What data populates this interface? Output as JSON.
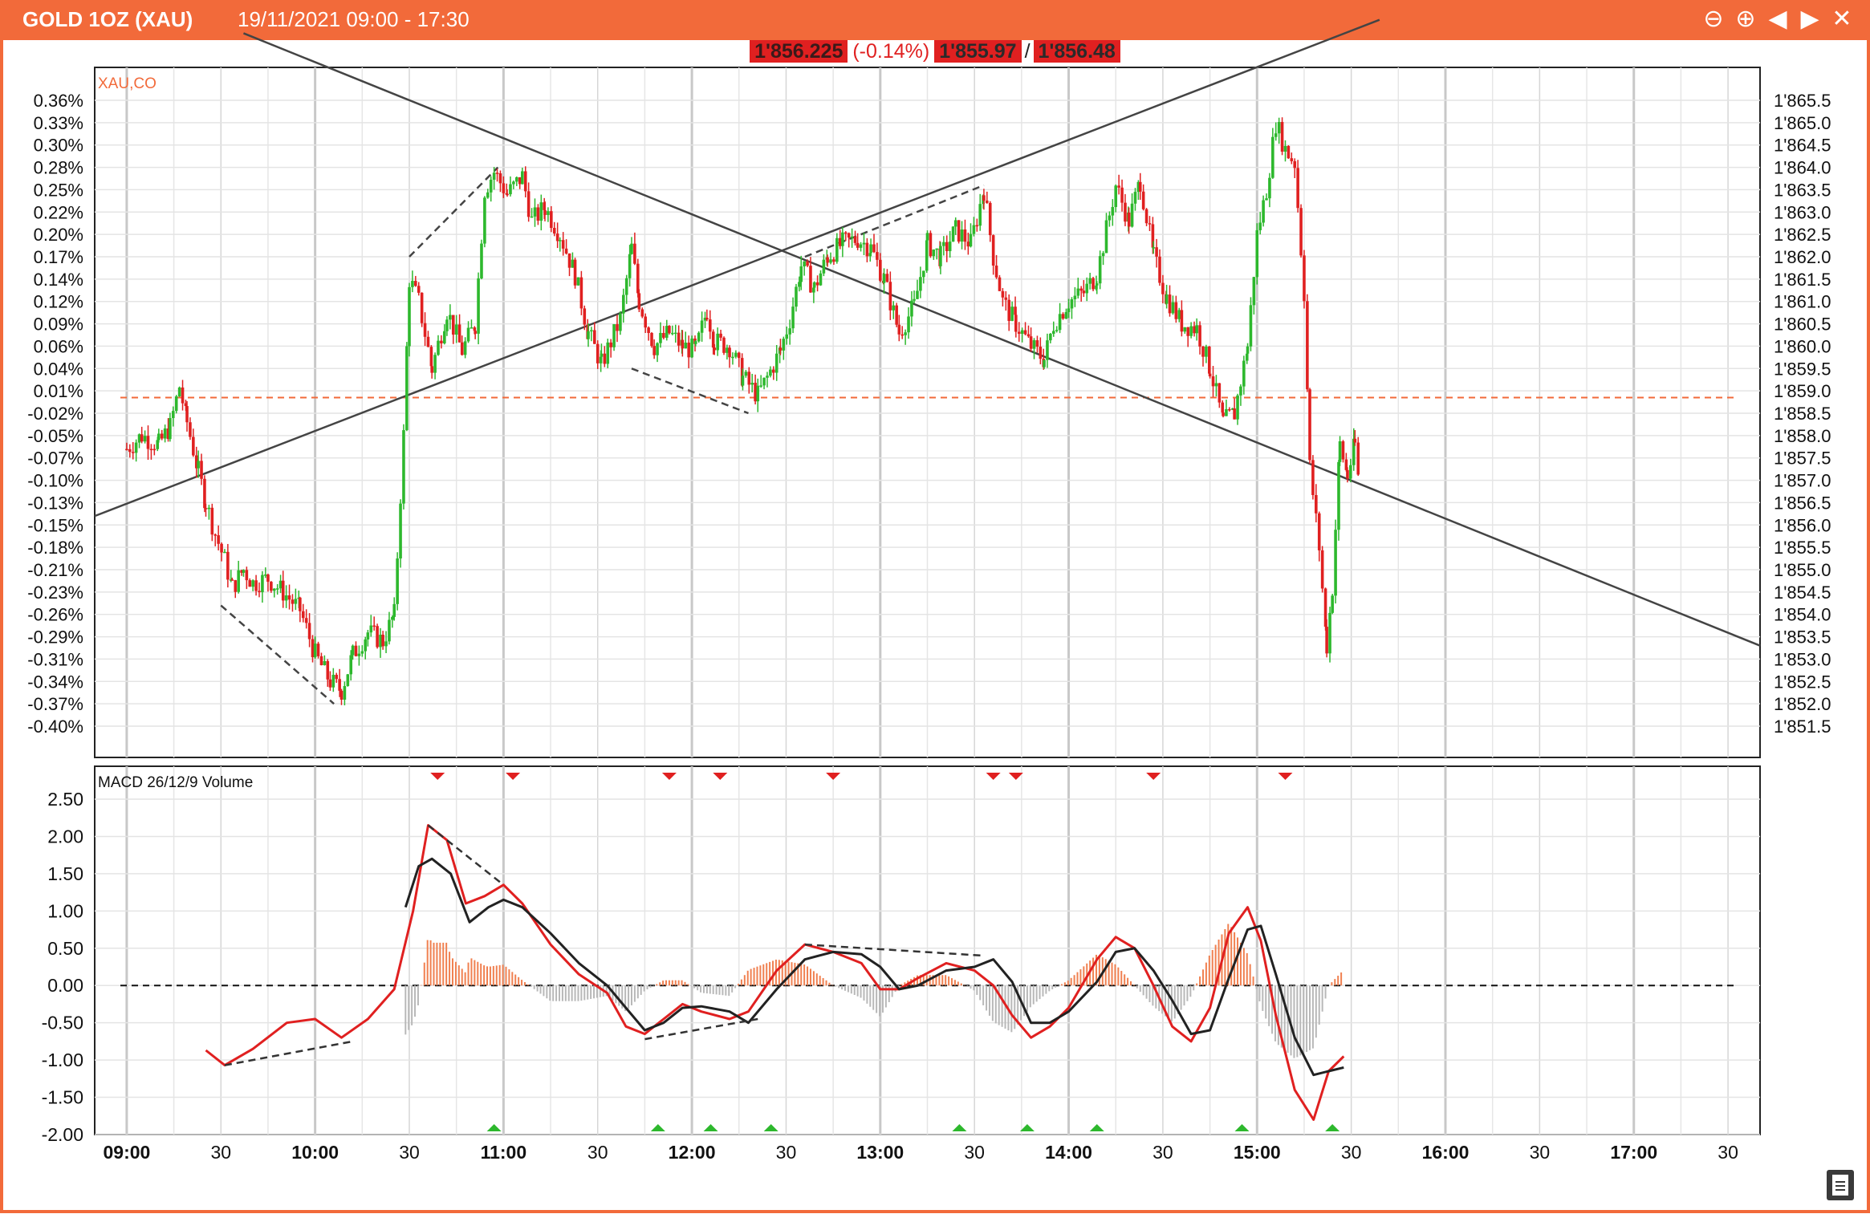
{
  "window": {
    "title": "GOLD 1OZ (XAU)",
    "range": "19/11/2021 09:00 - 17:30",
    "controls": [
      "zoom-out-icon",
      "zoom-in-icon",
      "prev-icon",
      "next-icon",
      "close-icon"
    ]
  },
  "quote": {
    "last": "1'856.225",
    "change": "(-0.14%)",
    "bid": "1'855.97",
    "sep": "/",
    "ask": "1'856.48"
  },
  "colors": {
    "accent": "#f26a3a",
    "up": "#2db82d",
    "down": "#e02020",
    "trend": "#444444",
    "signal": "#222222"
  },
  "chart_data": [
    {
      "type": "candlestick",
      "legend": "XAU,CO",
      "y_left_ticks": [
        "0.36%",
        "0.33%",
        "0.30%",
        "0.28%",
        "0.25%",
        "0.22%",
        "0.20%",
        "0.17%",
        "0.14%",
        "0.12%",
        "0.09%",
        "0.06%",
        "0.04%",
        "0.01%",
        "-0.02%",
        "-0.05%",
        "-0.07%",
        "-0.10%",
        "-0.13%",
        "-0.15%",
        "-0.18%",
        "-0.21%",
        "-0.23%",
        "-0.26%",
        "-0.29%",
        "-0.31%",
        "-0.34%",
        "-0.37%",
        "-0.40%"
      ],
      "y_right_ticks": [
        "1'865.5",
        "1'865.0",
        "1'864.5",
        "1'864.0",
        "1'863.5",
        "1'863.0",
        "1'862.5",
        "1'862.0",
        "1'861.5",
        "1'861.0",
        "1'860.5",
        "1'860.0",
        "1'859.5",
        "1'859.0",
        "1'858.5",
        "1'858.0",
        "1'857.5",
        "1'857.0",
        "1'856.5",
        "1'856.0",
        "1'855.5",
        "1'855.0",
        "1'854.5",
        "1'854.0",
        "1'853.5",
        "1'853.0",
        "1'852.5",
        "1'852.0",
        "1'851.5"
      ],
      "ylim": [
        1851.5,
        1865.5
      ],
      "reference_close": 1858.85,
      "x_range_hours": [
        8.83,
        17.67
      ],
      "price_path": [
        [
          9.0,
          1857.7
        ],
        [
          9.08,
          1858.0
        ],
        [
          9.17,
          1857.8
        ],
        [
          9.23,
          1858.2
        ],
        [
          9.28,
          1859.1
        ],
        [
          9.32,
          1858.3
        ],
        [
          9.38,
          1857.2
        ],
        [
          9.42,
          1856.5
        ],
        [
          9.47,
          1855.8
        ],
        [
          9.52,
          1855.2
        ],
        [
          9.56,
          1854.6
        ],
        [
          9.62,
          1855.0
        ],
        [
          9.67,
          1854.7
        ],
        [
          9.75,
          1854.8
        ],
        [
          9.83,
          1854.5
        ],
        [
          9.92,
          1854.1
        ],
        [
          10.0,
          1853.1
        ],
        [
          10.08,
          1852.5
        ],
        [
          10.14,
          1852.3
        ],
        [
          10.2,
          1853.1
        ],
        [
          10.28,
          1853.6
        ],
        [
          10.36,
          1853.4
        ],
        [
          10.42,
          1854.0
        ],
        [
          10.47,
          1858.0
        ],
        [
          10.5,
          1861.5
        ],
        [
          10.55,
          1861.0
        ],
        [
          10.62,
          1859.5
        ],
        [
          10.7,
          1860.8
        ],
        [
          10.78,
          1859.9
        ],
        [
          10.85,
          1860.5
        ],
        [
          10.9,
          1863.5
        ],
        [
          10.95,
          1863.9
        ],
        [
          11.02,
          1863.4
        ],
        [
          11.1,
          1863.8
        ],
        [
          11.15,
          1862.8
        ],
        [
          11.22,
          1863.1
        ],
        [
          11.3,
          1862.5
        ],
        [
          11.38,
          1861.6
        ],
        [
          11.45,
          1860.3
        ],
        [
          11.52,
          1859.6
        ],
        [
          11.62,
          1860.6
        ],
        [
          11.68,
          1862.2
        ],
        [
          11.72,
          1861.0
        ],
        [
          11.8,
          1860.0
        ],
        [
          11.88,
          1860.3
        ],
        [
          11.95,
          1860.0
        ],
        [
          12.02,
          1859.9
        ],
        [
          12.08,
          1860.8
        ],
        [
          12.12,
          1860.1
        ],
        [
          12.2,
          1860.0
        ],
        [
          12.27,
          1859.3
        ],
        [
          12.35,
          1858.9
        ],
        [
          12.4,
          1859.3
        ],
        [
          12.47,
          1859.9
        ],
        [
          12.52,
          1860.6
        ],
        [
          12.58,
          1861.8
        ],
        [
          12.65,
          1861.3
        ],
        [
          12.72,
          1862.0
        ],
        [
          12.8,
          1862.3
        ],
        [
          12.88,
          1862.4
        ],
        [
          12.95,
          1862.2
        ],
        [
          13.02,
          1861.5
        ],
        [
          13.1,
          1860.3
        ],
        [
          13.18,
          1860.9
        ],
        [
          13.25,
          1862.3
        ],
        [
          13.32,
          1862.0
        ],
        [
          13.4,
          1862.6
        ],
        [
          13.48,
          1862.3
        ],
        [
          13.55,
          1863.5
        ],
        [
          13.6,
          1862.0
        ],
        [
          13.65,
          1861.0
        ],
        [
          13.72,
          1860.5
        ],
        [
          13.8,
          1860.0
        ],
        [
          13.87,
          1859.7
        ],
        [
          13.92,
          1860.5
        ],
        [
          14.0,
          1861.0
        ],
        [
          14.08,
          1861.2
        ],
        [
          14.15,
          1861.6
        ],
        [
          14.25,
          1863.6
        ],
        [
          14.32,
          1862.8
        ],
        [
          14.38,
          1863.7
        ],
        [
          14.45,
          1862.0
        ],
        [
          14.52,
          1861.1
        ],
        [
          14.6,
          1860.5
        ],
        [
          14.68,
          1860.4
        ],
        [
          14.75,
          1859.5
        ],
        [
          14.82,
          1858.3
        ],
        [
          14.88,
          1858.5
        ],
        [
          14.95,
          1860.0
        ],
        [
          15.0,
          1862.5
        ],
        [
          15.05,
          1863.5
        ],
        [
          15.1,
          1865.0
        ],
        [
          15.15,
          1864.4
        ],
        [
          15.2,
          1864.1
        ],
        [
          15.25,
          1861.2
        ],
        [
          15.28,
          1857.3
        ],
        [
          15.33,
          1855.5
        ],
        [
          15.37,
          1853.3
        ],
        [
          15.4,
          1854.6
        ],
        [
          15.44,
          1857.8
        ],
        [
          15.48,
          1857.1
        ],
        [
          15.52,
          1857.8
        ],
        [
          15.55,
          1856.5
        ]
      ]
    },
    {
      "type": "line",
      "legend": "MACD 26/12/9 Volume",
      "y_ticks": [
        "2.50",
        "2.00",
        "1.50",
        "1.00",
        "0.50",
        "0.00",
        "-0.50",
        "-1.00",
        "-1.50",
        "-2.00"
      ],
      "ylim": [
        -2.0,
        2.5
      ],
      "x_ticks": [
        "09:00",
        "30",
        "10:00",
        "30",
        "11:00",
        "30",
        "12:00",
        "30",
        "13:00",
        "30",
        "14:00",
        "30",
        "15:00",
        "30",
        "16:00",
        "30",
        "17:00",
        "30"
      ],
      "series": [
        {
          "values": [
            [
              9.42,
              -0.87
            ],
            [
              9.52,
              -1.07
            ],
            [
              9.67,
              -0.85
            ],
            [
              9.85,
              -0.5
            ],
            [
              10.0,
              -0.45
            ],
            [
              10.14,
              -0.7
            ],
            [
              10.28,
              -0.45
            ],
            [
              10.42,
              -0.05
            ],
            [
              10.52,
              1.0
            ],
            [
              10.6,
              2.15
            ],
            [
              10.7,
              1.95
            ],
            [
              10.8,
              1.1
            ],
            [
              10.9,
              1.2
            ],
            [
              11.0,
              1.35
            ],
            [
              11.1,
              1.1
            ],
            [
              11.25,
              0.55
            ],
            [
              11.4,
              0.15
            ],
            [
              11.55,
              -0.1
            ],
            [
              11.65,
              -0.55
            ],
            [
              11.75,
              -0.65
            ],
            [
              11.85,
              -0.45
            ],
            [
              11.95,
              -0.25
            ],
            [
              12.05,
              -0.35
            ],
            [
              12.2,
              -0.45
            ],
            [
              12.3,
              -0.35
            ],
            [
              12.45,
              0.2
            ],
            [
              12.6,
              0.55
            ],
            [
              12.75,
              0.45
            ],
            [
              12.9,
              0.3
            ],
            [
              13.0,
              -0.05
            ],
            [
              13.1,
              -0.05
            ],
            [
              13.2,
              0.1
            ],
            [
              13.35,
              0.3
            ],
            [
              13.5,
              0.2
            ],
            [
              13.6,
              0.0
            ],
            [
              13.7,
              -0.4
            ],
            [
              13.8,
              -0.7
            ],
            [
              13.9,
              -0.55
            ],
            [
              14.0,
              -0.3
            ],
            [
              14.15,
              0.35
            ],
            [
              14.25,
              0.65
            ],
            [
              14.35,
              0.5
            ],
            [
              14.45,
              0.0
            ],
            [
              14.55,
              -0.55
            ],
            [
              14.65,
              -0.75
            ],
            [
              14.75,
              -0.3
            ],
            [
              14.85,
              0.7
            ],
            [
              14.95,
              1.05
            ],
            [
              15.02,
              0.6
            ],
            [
              15.1,
              -0.4
            ],
            [
              15.2,
              -1.4
            ],
            [
              15.3,
              -1.8
            ],
            [
              15.38,
              -1.15
            ],
            [
              15.46,
              -0.95
            ]
          ]
        },
        {
          "values": [
            [
              10.48,
              1.05
            ],
            [
              10.55,
              1.6
            ],
            [
              10.62,
              1.7
            ],
            [
              10.72,
              1.5
            ],
            [
              10.82,
              0.85
            ],
            [
              10.92,
              1.05
            ],
            [
              11.0,
              1.15
            ],
            [
              11.1,
              1.05
            ],
            [
              11.25,
              0.7
            ],
            [
              11.4,
              0.3
            ],
            [
              11.55,
              0.0
            ],
            [
              11.65,
              -0.3
            ],
            [
              11.75,
              -0.6
            ],
            [
              11.85,
              -0.5
            ],
            [
              11.95,
              -0.3
            ],
            [
              12.05,
              -0.28
            ],
            [
              12.2,
              -0.35
            ],
            [
              12.3,
              -0.5
            ],
            [
              12.45,
              -0.05
            ],
            [
              12.6,
              0.35
            ],
            [
              12.75,
              0.45
            ],
            [
              12.9,
              0.42
            ],
            [
              13.0,
              0.25
            ],
            [
              13.1,
              -0.05
            ],
            [
              13.2,
              0.0
            ],
            [
              13.35,
              0.2
            ],
            [
              13.5,
              0.25
            ],
            [
              13.6,
              0.35
            ],
            [
              13.7,
              0.05
            ],
            [
              13.8,
              -0.5
            ],
            [
              13.9,
              -0.5
            ],
            [
              14.0,
              -0.35
            ],
            [
              14.15,
              0.05
            ],
            [
              14.25,
              0.45
            ],
            [
              14.35,
              0.5
            ],
            [
              14.45,
              0.2
            ],
            [
              14.55,
              -0.2
            ],
            [
              14.65,
              -0.65
            ],
            [
              14.75,
              -0.6
            ],
            [
              14.85,
              0.1
            ],
            [
              14.95,
              0.75
            ],
            [
              15.02,
              0.8
            ],
            [
              15.1,
              0.15
            ],
            [
              15.2,
              -0.7
            ],
            [
              15.3,
              -1.2
            ],
            [
              15.38,
              -1.15
            ],
            [
              15.46,
              -1.1
            ]
          ]
        }
      ],
      "sell_signals_hours": [
        10.65,
        11.05,
        11.88,
        12.15,
        12.75,
        13.6,
        13.72,
        14.45,
        15.15
      ],
      "buy_signals_hours": [
        10.95,
        11.82,
        12.1,
        12.42,
        13.42,
        13.78,
        14.15,
        14.92,
        15.4
      ]
    }
  ]
}
